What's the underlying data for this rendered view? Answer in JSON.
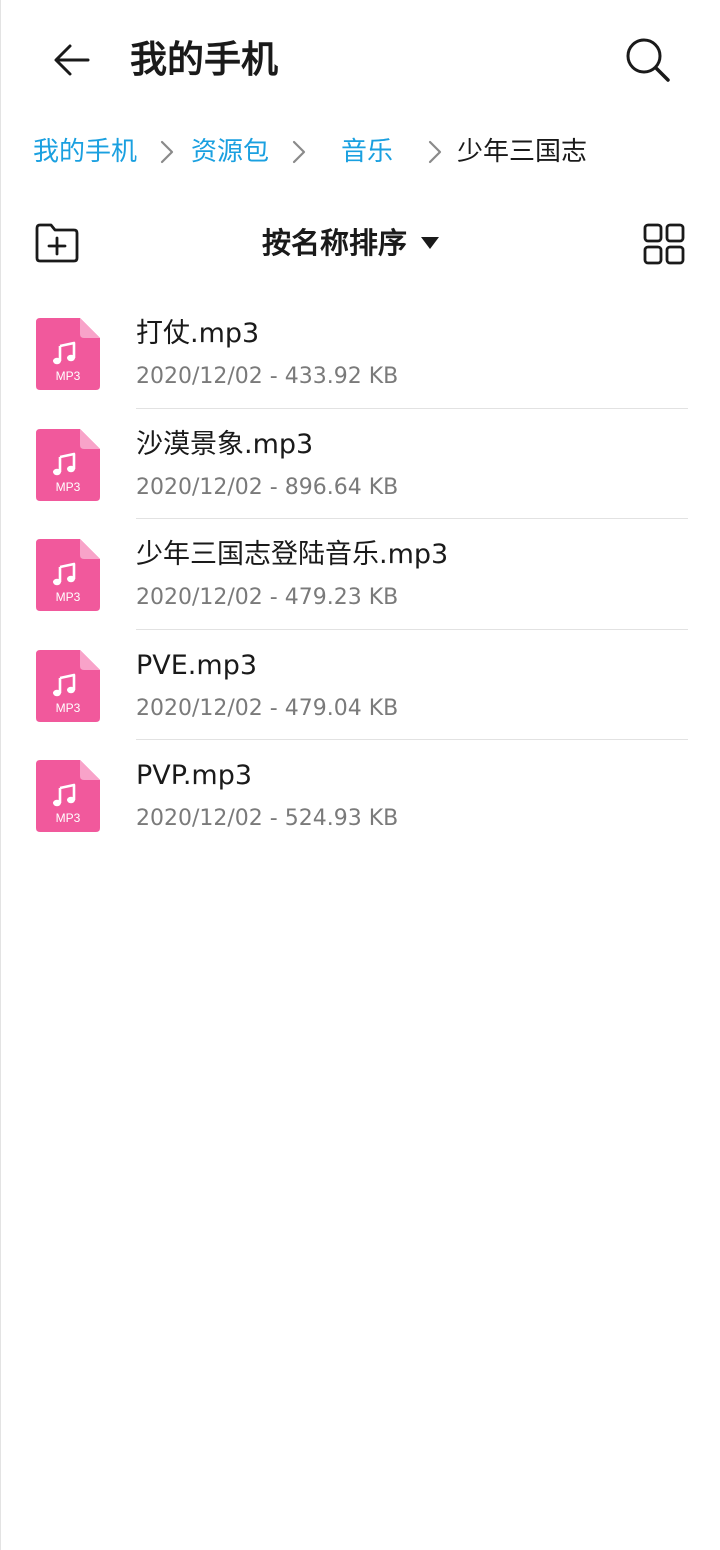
{
  "header": {
    "back_icon": "arrow-left-icon",
    "title": "我的手机",
    "search_icon": "search-icon"
  },
  "breadcrumb": {
    "items": [
      {
        "label": "我的手机",
        "current": false
      },
      {
        "label": "资源包",
        "current": false
      },
      {
        "label": "音乐",
        "current": false
      },
      {
        "label": "少年三国志",
        "current": true
      }
    ],
    "separator_icon": "chevron-right-icon"
  },
  "toolbar": {
    "new_folder_icon": "folder-plus-icon",
    "sort_label": "按名称排序",
    "sort_caret_icon": "caret-down-icon",
    "view_toggle_icon": "grid-view-icon"
  },
  "files": [
    {
      "name": "打仗.mp3",
      "meta": "2020/12/02 - 433.92 KB",
      "icon_label": "MP3"
    },
    {
      "name": "沙漠景象.mp3",
      "meta": "2020/12/02 - 896.64 KB",
      "icon_label": "MP3"
    },
    {
      "name": "少年三国志登陆音乐.mp3",
      "meta": "2020/12/02 - 479.23 KB",
      "icon_label": "MP3"
    },
    {
      "name": "PVE.mp3",
      "meta": "2020/12/02 - 479.04 KB",
      "icon_label": "MP3"
    },
    {
      "name": "PVP.mp3",
      "meta": "2020/12/02 - 524.93 KB",
      "icon_label": "MP3"
    }
  ],
  "colors": {
    "accent": "#1aa0e0",
    "file_icon": "#f1599c",
    "file_icon_fold": "#f8a3c9",
    "text_primary": "#1a1a1a",
    "text_secondary": "#7a7a7a"
  }
}
